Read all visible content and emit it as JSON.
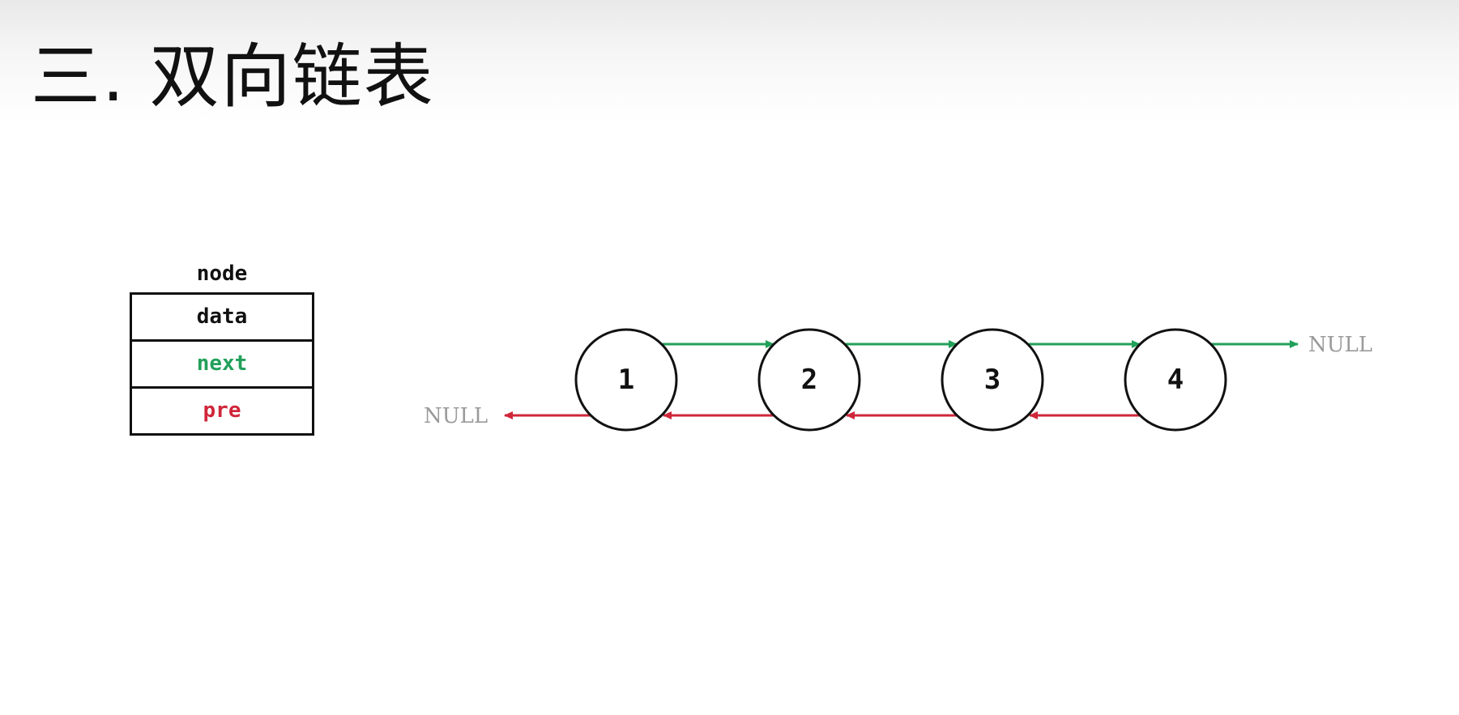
{
  "slide": {
    "title": "三. 双向链表"
  },
  "legend": {
    "header": "node",
    "fields": [
      "data",
      "next",
      "pre"
    ]
  },
  "diagram": {
    "nodes": [
      "1",
      "2",
      "3",
      "4"
    ],
    "null_right": "NULL",
    "null_left": "NULL"
  },
  "colors": {
    "next_arrow": "#22a05a",
    "pre_arrow": "#d0263a",
    "node_stroke": "#111111",
    "null_text": "#9a9a9a"
  }
}
